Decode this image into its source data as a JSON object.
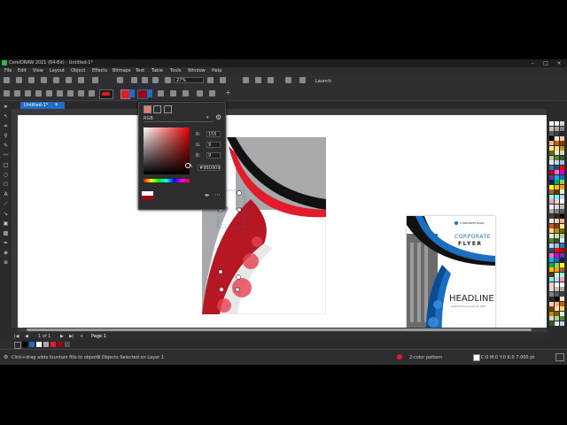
{
  "window": {
    "title": "CorelDRAW 2021 (64-Bit) - Untitled-1*"
  },
  "menu": [
    "File",
    "Edit",
    "View",
    "Layout",
    "Object",
    "Effects",
    "Bitmaps",
    "Text",
    "Table",
    "Tools",
    "Window",
    "Help"
  ],
  "toolbar": {
    "zoom": "27%",
    "launch_label": "Launch"
  },
  "document": {
    "tab_label": "Untitled-1*"
  },
  "color_picker": {
    "model": "RGB",
    "r_label": "R:",
    "r_value": "155",
    "g_label": "G:",
    "g_value": "9",
    "b_label": "B:",
    "b_value": "9",
    "hex_value": "#9B0909"
  },
  "flyer": {
    "brand": "CORPORATE BANK",
    "title_line1": "CORPORATE",
    "title_line2": "FLYER",
    "headline": "HEADLINE",
    "subtext": "LOREM IPSUM DOLOR SIT AMET"
  },
  "pagebar": {
    "page_counter": "1 of 1",
    "page_tab": "Page 1"
  },
  "status": {
    "hint": "Click+drag adds fountain fills to objects",
    "selection": "2 Objects Selected on Layer 1",
    "fill": "2-color pattern",
    "outline": "C:0 M:0 Y:0 K:0  7.000 pt"
  },
  "colors": {
    "accent": "#1f6ec4",
    "red_fill": "#9B0909",
    "bright_red": "#e21c2a",
    "flyer_blue": "#1a6fc0",
    "dark": "#1a1a1a"
  }
}
